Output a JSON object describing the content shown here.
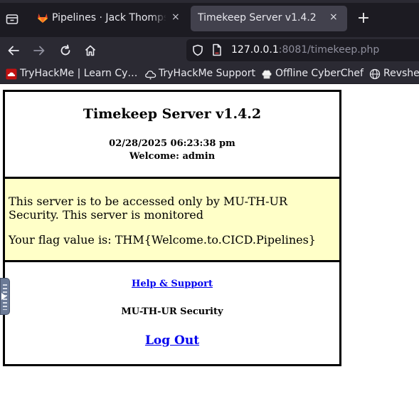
{
  "browser": {
    "tabs": [
      {
        "title": "Pipelines · Jack Thompson",
        "favicon": "gitlab-icon",
        "close": "×"
      },
      {
        "title": "Timekeep Server v1.4.2",
        "close": "×"
      }
    ],
    "new_tab": "+",
    "url": {
      "host": "127.0.0.1",
      "rest": ":8081/timekeep.php"
    },
    "bookmarks": [
      {
        "label": "TryHackMe | Learn Cy…",
        "icon": "tryhackme-icon"
      },
      {
        "label": "TryHackMe Support",
        "icon": "cloud-support-icon"
      },
      {
        "label": "Offline CyberChef",
        "icon": "chef-hat-icon"
      },
      {
        "label": "Revshel",
        "icon": "globe-icon"
      }
    ]
  },
  "page": {
    "title": "Timekeep Server v1.4.2",
    "datetime": "02/28/2025 06:23:38 pm",
    "welcome": "Welcome: admin",
    "notice": "This server is to be accessed only by MU-TH-UR Security. This server is monitored",
    "flag": "Your flag value is: THM{Welcome.to.CICD.Pipelines}",
    "help_link": "Help & Support",
    "security_label": "MU-TH-UR Security",
    "logout_link": "Log Out"
  },
  "colors": {
    "notice_bg": "#ffffc8",
    "link": "#0000ee",
    "chrome_dark": "#1c1b22",
    "chrome": "#2b2a33",
    "active_tab": "#42414d"
  }
}
